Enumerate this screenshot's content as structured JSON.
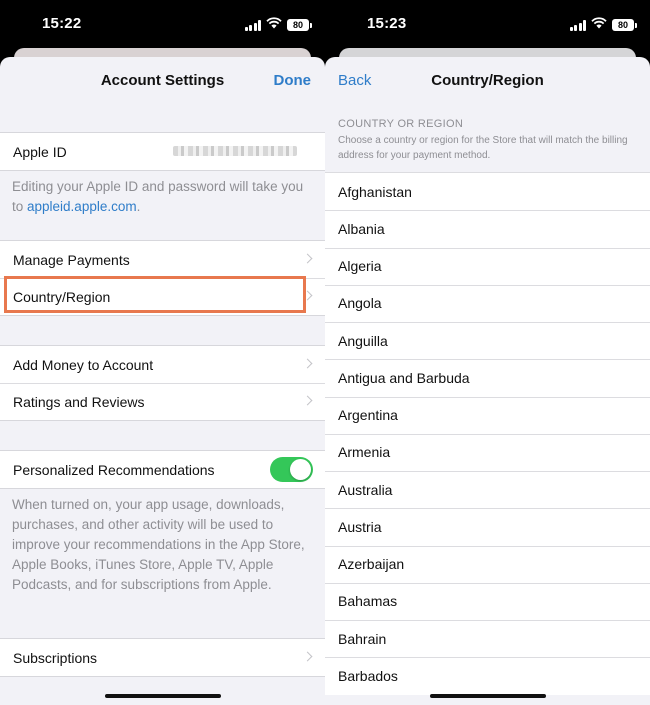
{
  "left": {
    "status": {
      "time": "15:22",
      "battery": "80"
    },
    "nav": {
      "title": "Account Settings",
      "done_label": "Done"
    },
    "apple_id": {
      "label": "Apple ID",
      "note_prefix": "Editing your Apple ID and password will take you to ",
      "note_link": "appleid.apple.com",
      "note_suffix": "."
    },
    "payments_group": {
      "manage_payments": "Manage Payments",
      "country_region": "Country/Region"
    },
    "money_group": {
      "add_money": "Add Money to Account",
      "ratings": "Ratings and Reviews"
    },
    "personalized": {
      "label": "Personalized Recommendations",
      "enabled": true,
      "toggle_color": "#34c759",
      "note": "When turned on, your app usage, downloads, purchases, and other activity will be used to improve your recommendations in the App Store, Apple Books, iTunes Store, Apple TV, Apple Podcasts, and for subscriptions from Apple."
    },
    "subscriptions": "Subscriptions",
    "highlight_color": "#e8784e"
  },
  "right": {
    "status": {
      "time": "15:23",
      "battery": "80"
    },
    "nav": {
      "back_label": "Back",
      "title": "Country/Region"
    },
    "section_header": "COUNTRY OR REGION",
    "section_sub": "Choose a country or region for the Store that will match the billing address for your payment method.",
    "countries": [
      "Afghanistan",
      "Albania",
      "Algeria",
      "Angola",
      "Anguilla",
      "Antigua and Barbuda",
      "Argentina",
      "Armenia",
      "Australia",
      "Austria",
      "Azerbaijan",
      "Bahamas",
      "Bahrain",
      "Barbados"
    ]
  },
  "colors": {
    "accent": "#2f7dc9",
    "background": "#f2f2f7"
  },
  "icons": [
    "signal-icon",
    "wifi-icon",
    "battery-icon",
    "chevron-right-icon"
  ]
}
